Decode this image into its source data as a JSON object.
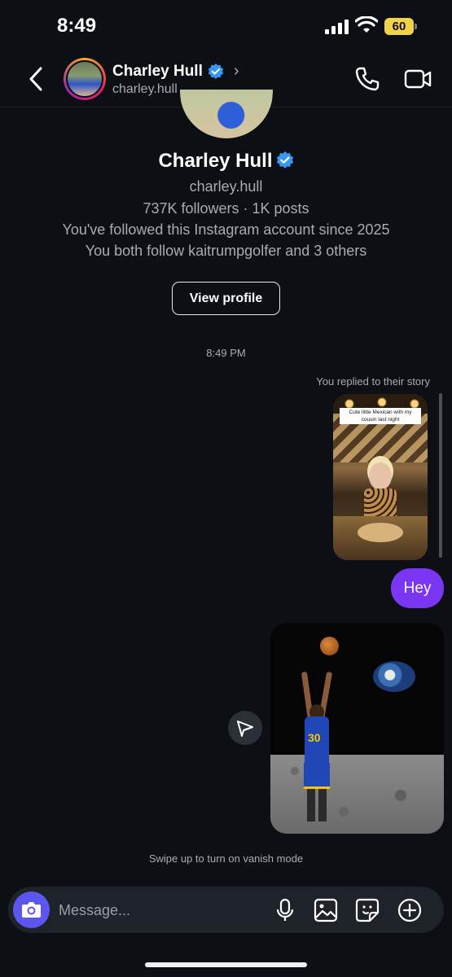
{
  "status_bar": {
    "time": "8:49",
    "battery": "60"
  },
  "header": {
    "name": "Charley Hull",
    "username": "charley.hull",
    "chevron": "›",
    "icons": [
      "back-chevron-icon",
      "verified-icon",
      "phone-icon",
      "video-camera-icon"
    ]
  },
  "profile": {
    "name": "Charley Hull",
    "username": "charley.hull",
    "stats": "737K followers · 1K posts",
    "followed_since": "You've followed this Instagram account since 2025",
    "mutuals": "You both follow kaitrumpgolfer and 3 others",
    "view_profile_label": "View profile"
  },
  "thread": {
    "timestamp": "8:49 PM",
    "story_reply_note": "You replied to their story",
    "story_caption": "Cute little Mexican with my cousin last night",
    "message_text": "Hey",
    "jersey_text": "30",
    "vanish_hint": "Swipe up to turn on vanish mode"
  },
  "composer": {
    "placeholder": "Message...",
    "icons": [
      "camera-icon",
      "microphone-icon",
      "gallery-icon",
      "sticker-icon",
      "add-icon"
    ]
  },
  "colors": {
    "background": "#0c0f14",
    "accent_purple": "#7b36f3",
    "camera_button": "#5c56f0",
    "verified_blue": "#3897f0",
    "battery_yellow": "#f0d34a"
  }
}
